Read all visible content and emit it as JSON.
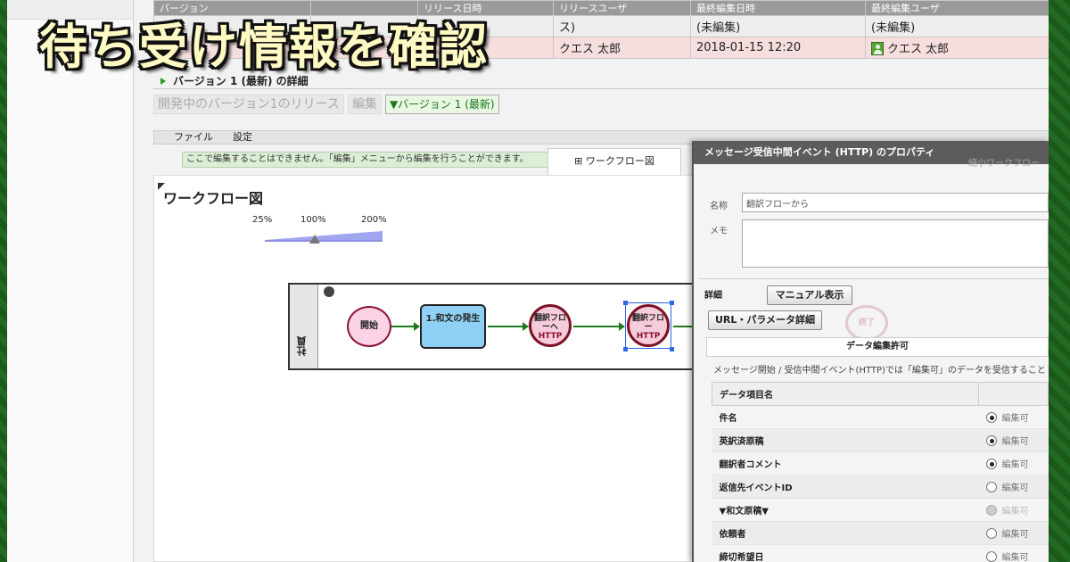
{
  "overlay_title": "待ち受け情報を確認",
  "version_table": {
    "headers": [
      "バージョン",
      "リリース日時",
      "リリースユーザ",
      "最終編集日時",
      "最終編集ユーザ"
    ],
    "rows": [
      {
        "release_user": "ス)",
        "last_edit_time": "(未編集)",
        "last_edit_user": "(未編集)"
      },
      {
        "release_user": "クエス 太郎",
        "last_edit_time": "2018-01-15 12:20",
        "last_edit_user": "クエス 太郎"
      }
    ]
  },
  "section_title": "バージョン 1 (最新) の詳細",
  "tabs": [
    "開発中のバージョン1のリリース",
    "編集",
    "▼バージョン 1 (最新)"
  ],
  "menu": [
    "ファイル",
    "設定"
  ],
  "info_message": "ここで編集することはできません。「編集」メニューから編集を行うことができます。",
  "workflow_tab": "ワークフロー図",
  "canvas_title": "ワークフロー図",
  "zoom_labels": [
    "25%",
    "100%",
    "200%"
  ],
  "zoom_level_percent": 100,
  "lane_name": "社員",
  "nodes": {
    "start": "開始",
    "task": "1.和文の発生",
    "http1": "翻訳フローへ",
    "http1_tag": "HTTP",
    "http2": "翻訳フロー",
    "http2_tag": "HTTP",
    "end": "終了"
  },
  "panel": {
    "title": "メッセージ受信中間イベント (HTTP) のプロパティ",
    "name_label": "名称",
    "name_value": "翻訳フローから",
    "memo_label": "メモ",
    "details_label": "詳細",
    "manual_button": "マニュアル表示",
    "url_button": "URL・パラメータ詳細",
    "perm_title": "データ編集許可",
    "perm_note": "メッセージ開始 / 受信中間イベント(HTTP)では「編集可」のデータを受信すること",
    "col_header": "データ項目名",
    "radio_label": "編集可",
    "items": [
      {
        "name": "件名",
        "state": "on"
      },
      {
        "name": "英訳済原稿",
        "state": "on"
      },
      {
        "name": "翻訳者コメント",
        "state": "on"
      },
      {
        "name": "返信先イベントID",
        "state": "off"
      },
      {
        "name": "▼和文原稿▼",
        "state": "disabled"
      },
      {
        "name": "依頼者",
        "state": "off"
      },
      {
        "name": "締切希望日",
        "state": "off"
      }
    ]
  },
  "ghost_right": "縮小ワークフロー"
}
